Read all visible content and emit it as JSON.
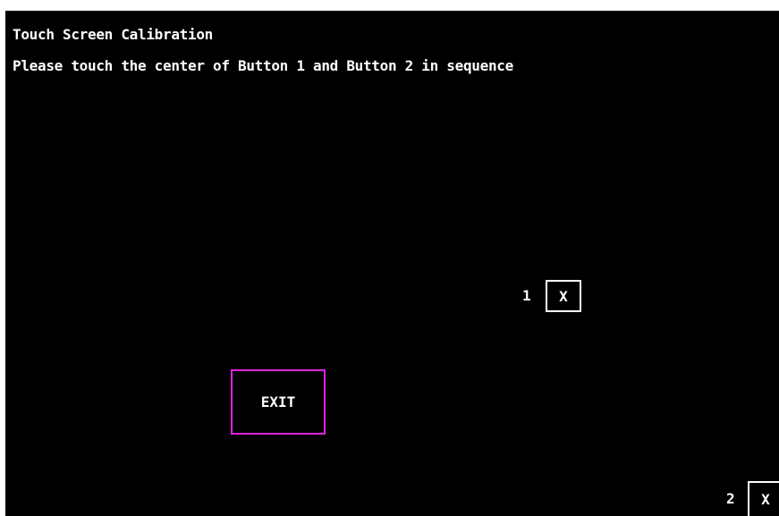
{
  "header": {
    "title": "Touch Screen Calibration",
    "instruction": "Please touch the center of Button 1 and Button 2 in sequence"
  },
  "targets": [
    {
      "label": "1",
      "mark": "X"
    },
    {
      "label": "2",
      "mark": "X"
    }
  ],
  "exit_button": {
    "label": "EXIT"
  },
  "colors": {
    "background": "#000000",
    "text": "#ffffff",
    "exit_border": "#e020e0",
    "target_border": "#ffffff"
  }
}
